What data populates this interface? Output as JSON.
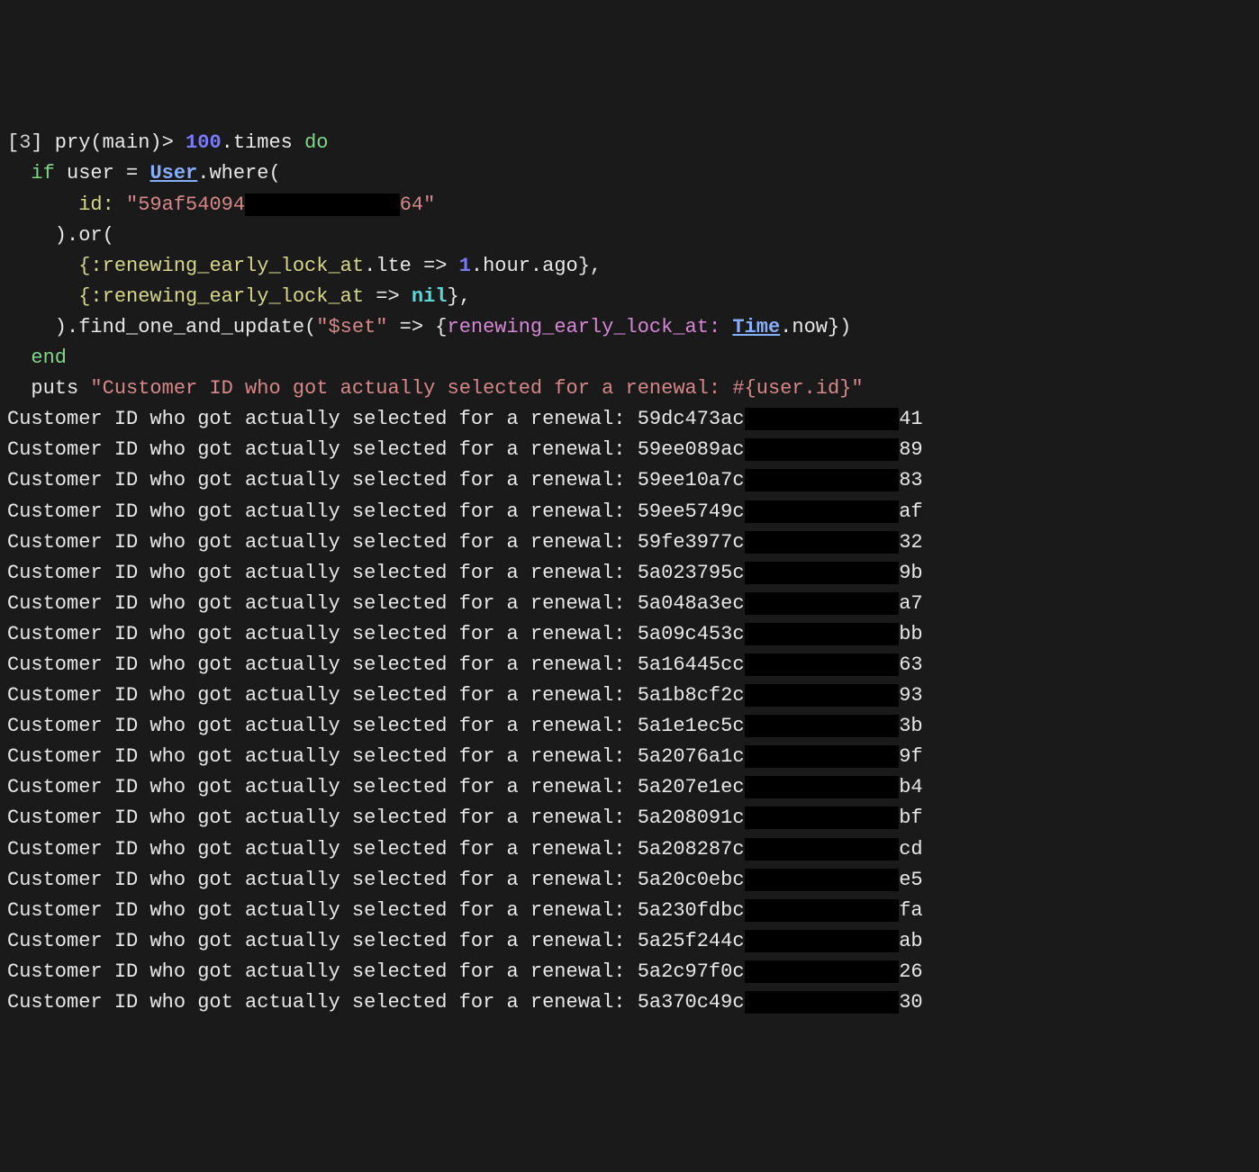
{
  "prompt": {
    "open": "[",
    "num": "3",
    "close": "] pry(main)> "
  },
  "code": {
    "times_n": "100",
    "dot_times_do": ".times ",
    "do": "do",
    "if_kw": "if",
    "l2_rest": " user = ",
    "user_class": "User",
    "where": ".where(",
    "id_key": "id:",
    "id_pre": " \"59af54094",
    "id_redact": "REDACTED",
    "id_post": "64\"",
    "or_line": "    ).or(",
    "sym1": "{:renewing_early_lock_at",
    "lte": ".lte => ",
    "one": "1",
    "hour_ago": ".hour.ago},",
    "sym2": "{:renewing_early_lock_at",
    "arrow_nil": " => ",
    "nil": "nil",
    "close_brace": "},",
    "foau_open": "    ).find_one_and_update(",
    "set": "\"$set\"",
    "arrow": " => {",
    "hashkey": "renewing_early_lock_at:",
    "space": " ",
    "time_class": "Time",
    "now_close": ".now})",
    "end": "end",
    "puts": "puts",
    "puts_str": " \"Customer ID who got actually selected for a renewal: #{user.id}\""
  },
  "output_prefix": "Customer ID who got actually selected for a renewal: ",
  "outputs": [
    {
      "pre": "59dc473ac",
      "post": "41"
    },
    {
      "pre": "59ee089ac",
      "post": "89"
    },
    {
      "pre": "59ee10a7c",
      "post": "83"
    },
    {
      "pre": "59ee5749c",
      "post": "af"
    },
    {
      "pre": "59fe3977c",
      "post": "32"
    },
    {
      "pre": "5a023795c",
      "post": "9b"
    },
    {
      "pre": "5a048a3ec",
      "post": "a7"
    },
    {
      "pre": "5a09c453c",
      "post": "bb"
    },
    {
      "pre": "5a16445cc",
      "post": "63"
    },
    {
      "pre": "5a1b8cf2c",
      "post": "93"
    },
    {
      "pre": "5a1e1ec5c",
      "post": "3b"
    },
    {
      "pre": "5a2076a1c",
      "post": "9f"
    },
    {
      "pre": "5a207e1ec",
      "post": "b4"
    },
    {
      "pre": "5a208091c",
      "post": "bf"
    },
    {
      "pre": "5a208287c",
      "post": "cd"
    },
    {
      "pre": "5a20c0ebc",
      "post": "e5"
    },
    {
      "pre": "5a230fdbc",
      "post": "fa"
    },
    {
      "pre": "5a25f244c",
      "post": "ab"
    },
    {
      "pre": "5a2c97f0c",
      "post": "26"
    },
    {
      "pre": "5a370c49c",
      "post": "30"
    }
  ]
}
